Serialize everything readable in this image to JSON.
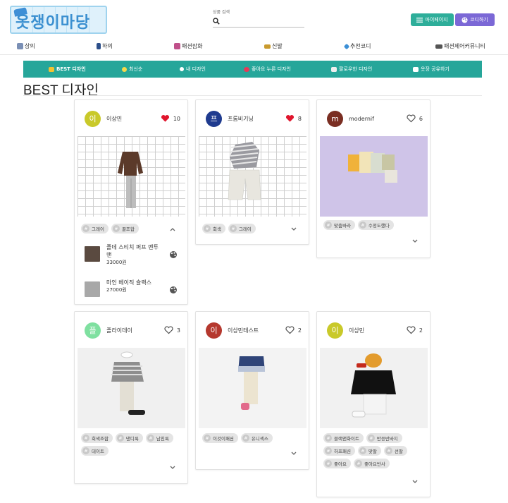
{
  "header": {
    "logo_text": "옷쟁이마당",
    "search_label": "상품 검색",
    "mypage_label": "마이페이지",
    "codi_label": "코디하기"
  },
  "categories": [
    {
      "label": "상의",
      "icon": "shirt-icon"
    },
    {
      "label": "하의",
      "icon": "pants-icon"
    },
    {
      "label": "패션잡화",
      "icon": "bag-icon"
    },
    {
      "label": "신발",
      "icon": "shoe-icon"
    },
    {
      "label": "추천코디",
      "icon": "diamond-icon"
    },
    {
      "label": "패션제어커뮤니티",
      "icon": "community-icon"
    }
  ],
  "subnav": [
    {
      "label": "BEST 디자인",
      "icon": "crown-icon"
    },
    {
      "label": "최신순",
      "icon": "sparkle-icon"
    },
    {
      "label": "내 디자인",
      "icon": "dot-icon"
    },
    {
      "label": "좋아요 누른 디자인",
      "icon": "heart-icon"
    },
    {
      "label": "팔로우한 디자인",
      "icon": "follow-icon"
    },
    {
      "label": "옷장 공유하기",
      "icon": "closet-icon"
    }
  ],
  "page_title": "BEST 디자인",
  "cards": [
    {
      "avatar": "이",
      "avatar_color": "#c9c92a",
      "user": "이상민",
      "likes": "10",
      "liked": true,
      "image": "grid",
      "tags": [
        "그레이",
        "꿀조합"
      ],
      "expanded": true,
      "items": [
        {
          "name": "플데 스티치 퍼프 맨투맨",
          "price": "33000원"
        },
        {
          "name": "마인 베이직 슬랙스",
          "price": "27000원"
        }
      ]
    },
    {
      "avatar": "프",
      "avatar_color": "#1f3b8f",
      "user": "프롬비기닝",
      "likes": "8",
      "liked": true,
      "image": "grid",
      "tags": [
        "회색",
        "그레이"
      ],
      "expanded": false,
      "items": []
    },
    {
      "avatar": "m",
      "avatar_color": "#7a2e22",
      "user": "modernif",
      "likes": "6",
      "liked": false,
      "image": "lavender",
      "tags": [
        "맞춤봐라",
        "수정도했다"
      ],
      "expanded": false,
      "items": []
    },
    {
      "avatar": "플",
      "avatar_color": "#7fe0a0",
      "user": "플라이데이",
      "likes": "3",
      "liked": false,
      "image": "light",
      "tags": [
        "회색조합",
        "댄디룩",
        "남친룩",
        "데이트"
      ],
      "expanded": false,
      "items": []
    },
    {
      "avatar": "이",
      "avatar_color": "#b5382e",
      "user": "이상민테스트",
      "likes": "2",
      "liked": false,
      "image": "light",
      "tags": [
        "이것이패션",
        "유니섹스"
      ],
      "expanded": false,
      "items": []
    },
    {
      "avatar": "이",
      "avatar_color": "#c9c92a",
      "user": "이상민",
      "likes": "2",
      "liked": false,
      "image": "light",
      "tags": [
        "블랙앤화이트",
        "반응반바지",
        "하프패션",
        "맞팔",
        "선팔",
        "좋아요",
        "좋아요반사"
      ],
      "expanded": false,
      "items": []
    }
  ]
}
